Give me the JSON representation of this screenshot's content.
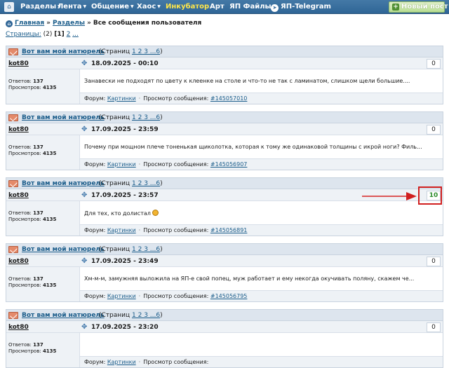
{
  "nav": {
    "items": [
      {
        "label": "Разделы",
        "caret": true
      },
      {
        "label": "Лента",
        "caret": true
      },
      {
        "label": "Общение",
        "caret": true
      },
      {
        "label": "Хаос",
        "caret": true
      },
      {
        "label": "Инкубатор",
        "caret": false
      },
      {
        "label": "Арт",
        "caret": false
      },
      {
        "label": "ЯП Файлы",
        "caret": false
      },
      {
        "label": "ЯП-Telegram",
        "caret": false
      }
    ],
    "new_post": "Новый пост",
    "home_icon": "home-icon",
    "telegram_icon": "telegram-icon",
    "colors": {
      "bar": "#2f6596",
      "highlight": "#ffe64a"
    }
  },
  "breadcrumb": {
    "home": "Главная",
    "sep1": "»",
    "sections": "Разделы",
    "sep2": "»",
    "current": "Все сообщения пользователя"
  },
  "pagination": {
    "label": "Страницы:",
    "count": "(2)",
    "current": "[1]",
    "next": "2",
    "more": "..."
  },
  "posts": [
    {
      "title": "Вот вам мой натюрель",
      "pages": {
        "prefix": "(Страниц",
        "links": "1 2 3 ...6",
        "suffix": ")"
      },
      "author": "kot80",
      "date": "18.09.2025 - 00:10",
      "rating": "0",
      "replies_label": "Ответов:",
      "replies": "137",
      "views_label": "Просмотров:",
      "views": "4135",
      "text": "Занавески не подходят по цвету к клеенке на столе и что-то не так с ламинатом, слишком щели большие....",
      "forum_label": "Форум:",
      "forum": "Картинки",
      "view_label": "Просмотр сообщения:",
      "msg_id": "#145057010"
    },
    {
      "title": "Вот вам мой натюрель",
      "pages": {
        "prefix": "(Страниц",
        "links": "1 2 3 ...6",
        "suffix": ")"
      },
      "author": "kot80",
      "date": "17.09.2025 - 23:59",
      "rating": "0",
      "replies_label": "Ответов:",
      "replies": "137",
      "views_label": "Просмотров:",
      "views": "4135",
      "text": "Почему при мощном плече тоненькая щиколотка, которая к тому же одинаковой толщины с икрой ноги? Филь...",
      "forum_label": "Форум:",
      "forum": "Картинки",
      "view_label": "Просмотр сообщения:",
      "msg_id": "#145056907"
    },
    {
      "title": "Вот вам мой натюрель",
      "pages": {
        "prefix": "(Страниц",
        "links": "1 2 3 ...6",
        "suffix": ")"
      },
      "author": "kot80",
      "date": "17.09.2025 - 23:57",
      "rating": "10",
      "replies_label": "Ответов:",
      "replies": "137",
      "views_label": "Просмотров:",
      "views": "4135",
      "text": "Для тех, кто долистал",
      "forum_label": "Форум:",
      "forum": "Картинки",
      "view_label": "Просмотр сообщения:",
      "msg_id": "#145056891"
    },
    {
      "title": "Вот вам мой натюрель",
      "pages": {
        "prefix": "(Страниц",
        "links": "1 2 3 ...6",
        "suffix": ")"
      },
      "author": "kot80",
      "date": "17.09.2025 - 23:49",
      "rating": "0",
      "replies_label": "Ответов:",
      "replies": "137",
      "views_label": "Просмотров:",
      "views": "4135",
      "text": "Хм-м-м, замужняя выложила на ЯП-е свой попец, муж работает и ему некогда окучивать поляну, скажем че...",
      "forum_label": "Форум:",
      "forum": "Картинки",
      "view_label": "Просмотр сообщения:",
      "msg_id": "#145056795"
    },
    {
      "title": "Вот вам мой натюрель",
      "pages": {
        "prefix": "(Страниц",
        "links": "1 2 3 ...6",
        "suffix": ")"
      },
      "author": "kot80",
      "date": "17.09.2025 - 23:20",
      "rating": "0",
      "replies_label": "Ответов:",
      "replies": "137",
      "views_label": "Просмотров:",
      "views": "4135",
      "text": "",
      "forum_label": "Форум:",
      "forum": "Картинки",
      "view_label": "Просмотр сообщения:",
      "msg_id": ""
    }
  ],
  "annotation": {
    "color": "#d01f1f",
    "rating_color": "#2a8a2a"
  }
}
